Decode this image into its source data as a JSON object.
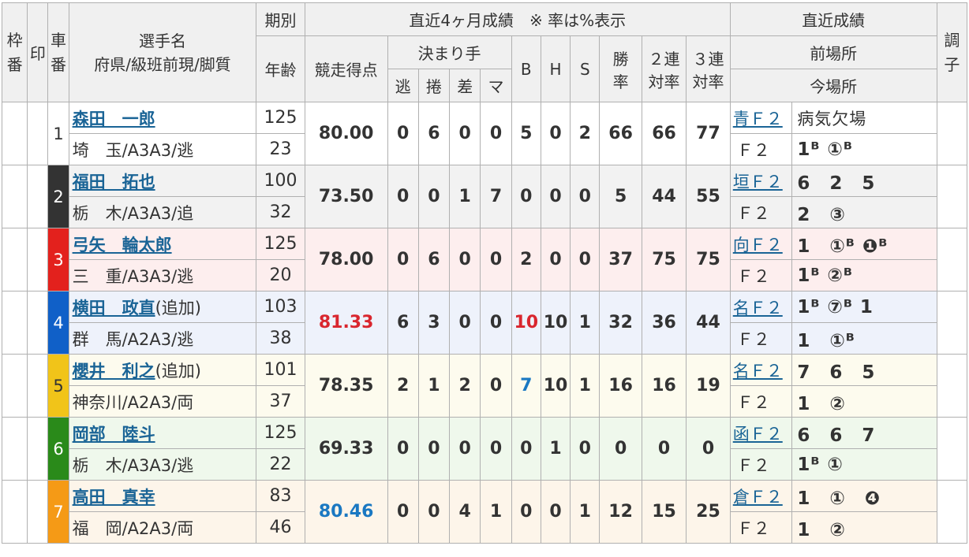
{
  "header": {
    "waku": "枠番",
    "mark": "印",
    "car": "車番",
    "player_name": "選手名",
    "player_info": "府県/級班前現/脚質",
    "term": "期別",
    "age": "年齢",
    "recent4": "直近4ヶ月成績　※ 率は%表示",
    "score": "競走得点",
    "kimarite": "決まり手",
    "nige": "逃",
    "makuri": "捲",
    "sashi": "差",
    "mark_k": "マ",
    "b": "B",
    "h": "H",
    "s": "S",
    "win_rate_1": "勝",
    "win_rate_2": "率",
    "rate2_1": "２連",
    "rate2_2": "対率",
    "rate3_1": "３連",
    "rate3_2": "対率",
    "recent_results": "直近成績",
    "prev_venue": "前場所",
    "curr_venue": "今場所",
    "condition": "調子"
  },
  "colors": {
    "waku1": "#ffffff",
    "waku2": "#333333",
    "waku3": "#e3211d",
    "waku4": "#1060c8",
    "waku5": "#f1c419",
    "waku6": "#2a8a1a",
    "waku7": "#f59a16",
    "link": "#1a6496",
    "highlight_red": "#d9262e",
    "highlight_blue": "#1a78c2",
    "header_bg": "#f0f0f0"
  },
  "riders": [
    {
      "car": "1",
      "name": "森田　一郎",
      "added": "",
      "info": "埼　玉/A3A3/逃",
      "term": "125",
      "age": "23",
      "score": "80.00",
      "nige": "0",
      "makuri": "6",
      "sashi": "0",
      "mark": "0",
      "b": "5",
      "h": "0",
      "s": "2",
      "win": "66",
      "r2": "66",
      "r3": "77",
      "prev_venue": "青Ｆ２",
      "prev_results": "病気欠場",
      "curr_venue": "Ｆ２",
      "curr_results": "1ᴮ ①ᴮ"
    },
    {
      "car": "2",
      "name": "福田　拓也",
      "added": "",
      "info": "栃　木/A3A3/追",
      "term": "100",
      "age": "32",
      "score": "73.50",
      "nige": "0",
      "makuri": "0",
      "sashi": "1",
      "mark": "7",
      "b": "0",
      "h": "0",
      "s": "0",
      "win": "5",
      "r2": "44",
      "r3": "55",
      "prev_venue": "垣Ｆ２",
      "prev_results": "6　2　5",
      "curr_venue": "Ｆ２",
      "curr_results": "2　③"
    },
    {
      "car": "3",
      "name": "弓矢　輪太郎",
      "added": "",
      "info": "三　重/A3A3/逃",
      "term": "125",
      "age": "20",
      "score": "78.00",
      "nige": "0",
      "makuri": "6",
      "sashi": "0",
      "mark": "0",
      "b": "2",
      "h": "0",
      "s": "0",
      "win": "37",
      "r2": "75",
      "r3": "75",
      "prev_venue": "向Ｆ２",
      "prev_results": "1　①ᴮ ❶ᴮ",
      "curr_venue": "Ｆ２",
      "curr_results": "1ᴮ ②ᴮ"
    },
    {
      "car": "4",
      "name": "横田　政直",
      "added": "(追加)",
      "info": "群　馬/A2A3/逃",
      "term": "103",
      "age": "38",
      "score": "81.33",
      "nige": "6",
      "makuri": "3",
      "sashi": "0",
      "mark": "0",
      "b": "10",
      "h": "10",
      "s": "1",
      "win": "32",
      "r2": "36",
      "r3": "44",
      "prev_venue": "名Ｆ２",
      "prev_results": "1ᴮ ⑦ᴮ 1",
      "curr_venue": "Ｆ２",
      "curr_results": "1　①ᴮ"
    },
    {
      "car": "5",
      "name": "櫻井　利之",
      "added": "(追加)",
      "info": "神奈川/A2A3/両",
      "term": "101",
      "age": "37",
      "score": "78.35",
      "nige": "2",
      "makuri": "1",
      "sashi": "2",
      "mark": "0",
      "b": "7",
      "h": "10",
      "s": "1",
      "win": "16",
      "r2": "16",
      "r3": "19",
      "prev_venue": "名Ｆ２",
      "prev_results": "7　6　5",
      "curr_venue": "Ｆ２",
      "curr_results": "1　②"
    },
    {
      "car": "6",
      "name": "岡部　陸斗",
      "added": "",
      "info": "栃　木/A3A3/逃",
      "term": "125",
      "age": "22",
      "score": "69.33",
      "nige": "0",
      "makuri": "0",
      "sashi": "0",
      "mark": "0",
      "b": "0",
      "h": "1",
      "s": "0",
      "win": "0",
      "r2": "0",
      "r3": "0",
      "prev_venue": "函Ｆ２",
      "prev_results": "6　6　7",
      "curr_venue": "Ｆ２",
      "curr_results": "1ᴮ ①"
    },
    {
      "car": "7",
      "name": "高田　真幸",
      "added": "",
      "info": "福　岡/A2A3/両",
      "term": "83",
      "age": "46",
      "score": "80.46",
      "nige": "0",
      "makuri": "0",
      "sashi": "4",
      "mark": "1",
      "b": "0",
      "h": "0",
      "s": "1",
      "win": "12",
      "r2": "15",
      "r3": "25",
      "prev_venue": "倉Ｆ２",
      "prev_results": "1　①　❹",
      "curr_venue": "Ｆ２",
      "curr_results": "1　②"
    }
  ]
}
